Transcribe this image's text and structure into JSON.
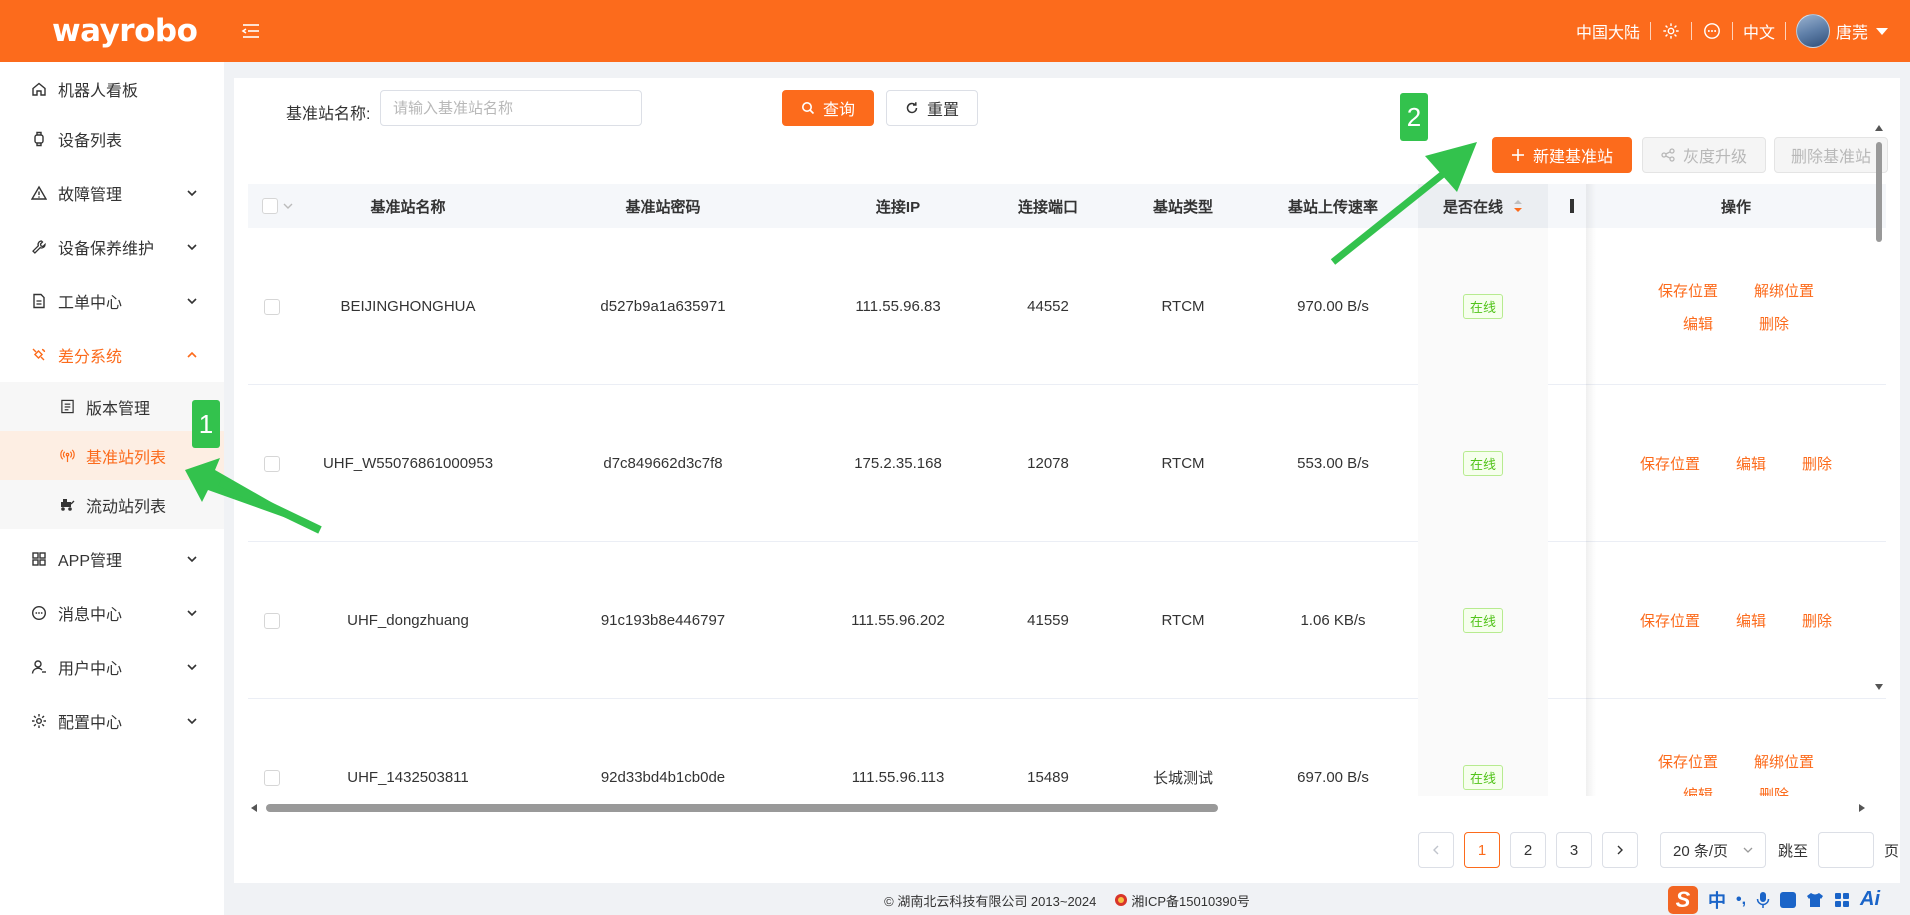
{
  "header": {
    "logo": "wayrobo",
    "region": "中国大陆",
    "language": "中文",
    "username": "唐莞",
    "brand_color": "#fc6b1c"
  },
  "sidebar": {
    "items": [
      {
        "label": "机器人看板",
        "icon": "home-icon"
      },
      {
        "label": "设备列表",
        "icon": "watch-icon"
      },
      {
        "label": "故障管理",
        "icon": "warning-icon"
      },
      {
        "label": "设备保养维护",
        "icon": "wrench-icon"
      },
      {
        "label": "工单中心",
        "icon": "document-icon"
      },
      {
        "label": "差分系统",
        "icon": "satellite-icon"
      },
      {
        "label": "APP管理",
        "icon": "grid-icon"
      },
      {
        "label": "消息中心",
        "icon": "chat-icon"
      },
      {
        "label": "用户中心",
        "icon": "user-icon"
      },
      {
        "label": "配置中心",
        "icon": "gear-icon"
      }
    ],
    "sub_items": [
      {
        "label": "版本管理",
        "icon": "list-icon"
      },
      {
        "label": "基准站列表",
        "icon": "antenna-icon"
      },
      {
        "label": "流动站列表",
        "icon": "rover-icon"
      }
    ]
  },
  "search": {
    "label": "基准站名称:",
    "placeholder": "请输入基准站名称",
    "query_label": "查询",
    "reset_label": "重置"
  },
  "toolbar": {
    "new_label": "新建基准站",
    "upgrade_label": "灰度升级",
    "delete_label": "删除基准站"
  },
  "table": {
    "columns": [
      "基准站名称",
      "基准站密码",
      "连接IP",
      "连接端口",
      "基站类型",
      "基站上传速率",
      "是否在线",
      "操作"
    ],
    "rows": [
      {
        "name": "BEIJINGHONGHUA",
        "password": "d527b9a1a635971",
        "ip": "111.55.96.83",
        "port": "44552",
        "type": "RTCM",
        "rate": "970.00 B/s",
        "online": "在线",
        "ops": [
          [
            "保存位置",
            "解绑位置"
          ],
          [
            "编辑",
            "删除"
          ]
        ]
      },
      {
        "name": "UHF_W55076861000953",
        "password": "d7c849662d3c7f8",
        "ip": "175.2.35.168",
        "port": "12078",
        "type": "RTCM",
        "rate": "553.00 B/s",
        "online": "在线",
        "ops": [
          [
            "保存位置",
            "编辑",
            "删除"
          ]
        ]
      },
      {
        "name": "UHF_dongzhuang",
        "password": "91c193b8e446797",
        "ip": "111.55.96.202",
        "port": "41559",
        "type": "RTCM",
        "rate": "1.06 KB/s",
        "online": "在线",
        "ops": [
          [
            "保存位置",
            "编辑",
            "删除"
          ]
        ]
      },
      {
        "name": "UHF_1432503811",
        "password": "92d33bd4b1cb0de",
        "ip": "111.55.96.113",
        "port": "15489",
        "type": "长城测试",
        "rate": "697.00 B/s",
        "online": "在线",
        "ops": [
          [
            "保存位置",
            "解绑位置"
          ],
          [
            "编辑",
            "删除"
          ]
        ]
      }
    ]
  },
  "pagination": {
    "pages": [
      "1",
      "2",
      "3"
    ],
    "current": "1",
    "page_size": "20 条/页",
    "jump_label": "跳至",
    "page_suffix": "页"
  },
  "footer": {
    "copyright": "© 湖南北云科技有限公司 2013~2024",
    "icp": "湘ICP备15010390号"
  },
  "annotations": {
    "marker1": "1",
    "marker2": "2",
    "marker_color": "#33c24d"
  },
  "ime": {
    "logo": "S",
    "mode": "中",
    "ai": "Ai"
  }
}
